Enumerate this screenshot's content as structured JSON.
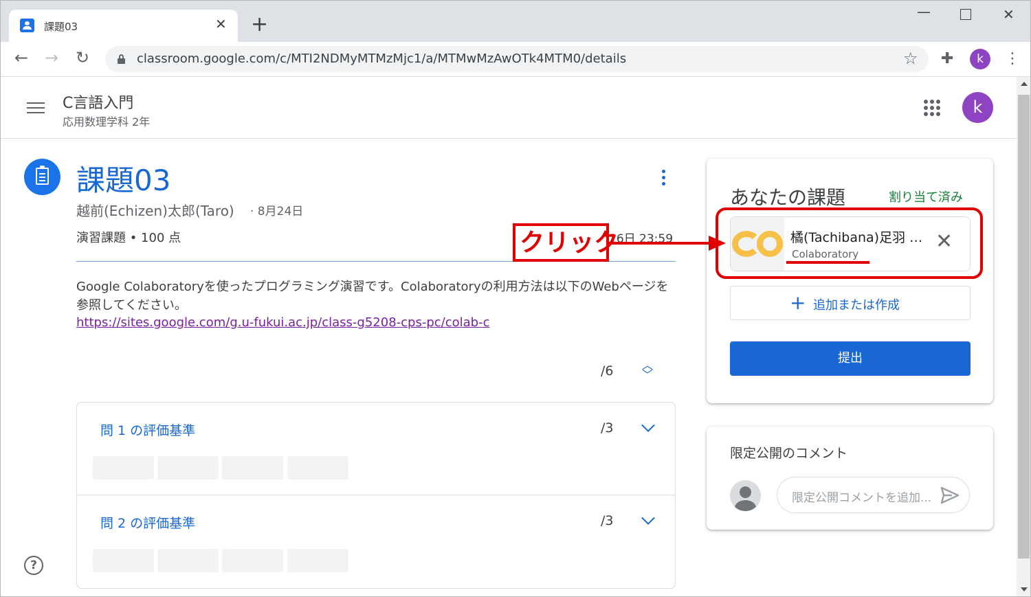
{
  "browser": {
    "tab_title": "課題03",
    "url": "classroom.google.com/c/MTI2NDMyMTMzMjc1/a/MTMwMzAwOTk4MTM0/details",
    "profile_initial": "k"
  },
  "header": {
    "class_name": "C言語入門",
    "class_section": "応用数理学科 2年",
    "avatar_initial": "k"
  },
  "assignment": {
    "title": "課題03",
    "author": "越前(Echizen)太郎(Taro)",
    "posted_date": "· 8月24日",
    "meta": "演習課題 • 100 点",
    "due": "26日 23:59",
    "description": "Google Colaboratoryを使ったプログラミング演習です。Colaboratoryの利用方法は以下のWebページを参照してください。",
    "link": "https://sites.google.com/g.u-fukui.ac.jp/class-g5208-cps-pc/colab-c"
  },
  "rubric": {
    "total_points": "/6",
    "criteria": [
      {
        "title": "問 1 の評価基準",
        "points": "/3"
      },
      {
        "title": "問 2 の評価基準",
        "points": "/3"
      }
    ]
  },
  "your_work": {
    "title": "あなたの課題",
    "status": "割り当て済み",
    "attachment_name": "橘(Tachibana)足羽 …",
    "attachment_type": "Colaboratory",
    "add_label": "追加または作成",
    "submit_label": "提出"
  },
  "private_comments": {
    "title": "限定公開のコメント",
    "placeholder": "限定公開コメントを追加..."
  },
  "annotation": {
    "label": "クリック",
    "color": "#e00000"
  },
  "colors": {
    "accent": "#1967d2",
    "status_green": "#188038",
    "avatar_purple": "#8e44c2"
  }
}
